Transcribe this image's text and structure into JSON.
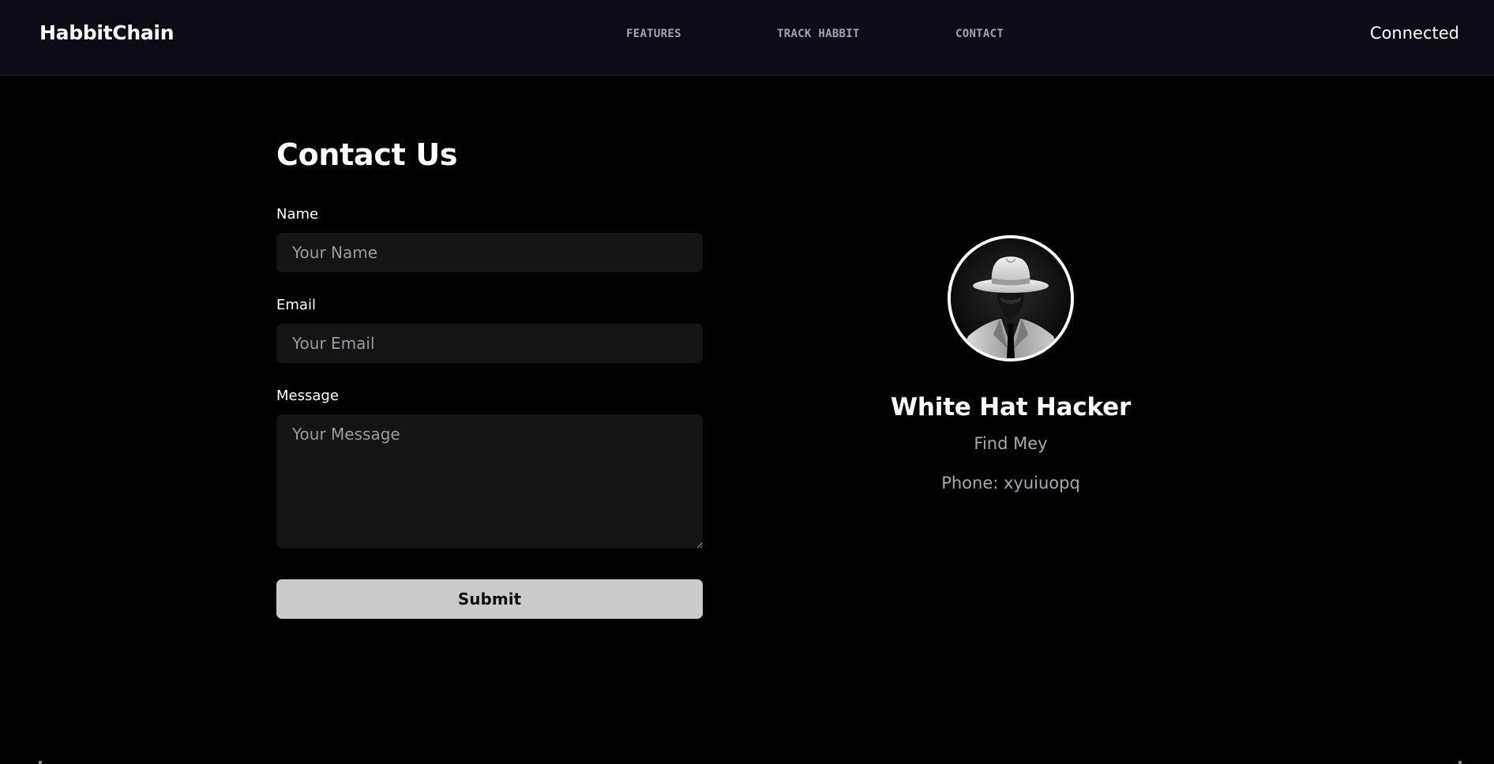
{
  "header": {
    "brand": "HabbitChain",
    "nav": [
      {
        "label": "FEATURES"
      },
      {
        "label": "TRACK HABBIT"
      },
      {
        "label": "CONTACT"
      }
    ],
    "status": "Connected"
  },
  "form": {
    "title": "Contact Us",
    "name_label": "Name",
    "name_placeholder": "Your Name",
    "email_label": "Email",
    "email_placeholder": "Your Email",
    "message_label": "Message",
    "message_placeholder": "Your Message",
    "submit_label": "Submit"
  },
  "profile": {
    "avatar_icon": "hat-figure-avatar",
    "name": "White Hat Hacker",
    "line1": "Find Mey",
    "line2": "Phone: xyuiuopq"
  },
  "colors": {
    "background": "#000000",
    "header_bg": "#0c0b16",
    "input_bg": "#141414",
    "button_bg": "#cbcbcb",
    "muted_text": "#a9a9b3"
  }
}
